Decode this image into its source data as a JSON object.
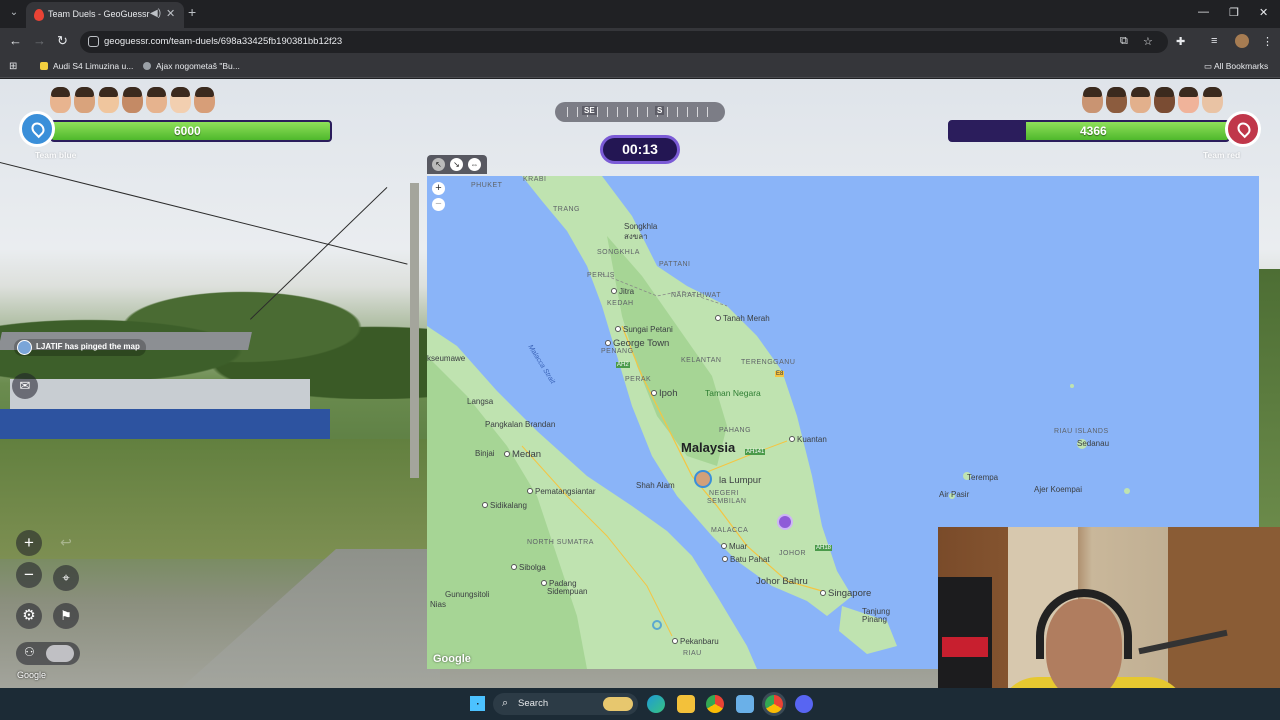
{
  "browser": {
    "tab_title": "Team Duels - GeoGuessr",
    "tab_icons": [
      "geoguessr-pin-icon",
      "speaker-icon",
      "close-icon"
    ],
    "url": "geoguessr.com/team-duels/698a33425fb190381bb12f23",
    "bookmarks": [
      {
        "label": "Audi S4 Limuzina u...",
        "color": "#f4d03f"
      },
      {
        "label": "Ajax nogometaš \"Bu...",
        "color": "#9aa0a6"
      }
    ],
    "all_bookmarks": "All Bookmarks"
  },
  "game": {
    "team_blue": {
      "label": "Team blue",
      "health": "6000",
      "health_fraction": 1.0,
      "color": "#3a8fd9"
    },
    "team_red": {
      "label": "Team red",
      "health": "4366",
      "health_fraction": 0.7277,
      "color": "#c0374a"
    },
    "compass": {
      "left": "SE",
      "center": "S"
    },
    "timer": "00:13",
    "ping_message": "LJATIF has pinged the map"
  },
  "map": {
    "labels": {
      "phuket": "PHUKET",
      "krabi": "KRABI",
      "trang": "TRANG",
      "songkhla": "Songkhla",
      "songkhla_thai": "สงขลา",
      "songkhla_region": "SONGKHLA",
      "pattani": "PATTANI",
      "perlis": "PERLIS",
      "jitra": "Jitra",
      "kedah": "KEDAH",
      "narathiwat": "NARATHIWAT",
      "tanah_merah": "Tanah Merah",
      "sungai_petani": "Sungai Petani",
      "george_town": "George Town",
      "penang": "PENANG",
      "kelantan": "KELANTAN",
      "terengganu": "TERENGGANU",
      "seumawe": "kseumawe",
      "malacca_strait": "Malacca Strait",
      "perak": "PERAK",
      "ipoh": "Ipoh",
      "taman_negara": "Taman Negara",
      "langsa": "Langsa",
      "pangkalan_brandan": "Pangkalan Brandan",
      "pahang": "PAHANG",
      "malaysia": "Malaysia",
      "kuantan": "Kuantan",
      "binjai": "Binjai",
      "medan": "Medan",
      "kuala_lumpur": "la Lumpur",
      "shah_alam": "Shah Alam",
      "negeri": "NEGERI",
      "sembilan": "SEMBILAN",
      "pematangsiantar": "Pematangsiantar",
      "sidikalang": "Sidikalang",
      "malacca": "MALACCA",
      "north_sumatra": "NORTH SUMATRA",
      "muar": "Muar",
      "johor": "JOHOR",
      "batu_pahat": "Batu Pahat",
      "sibolga": "Sibolga",
      "johor_bahru": "Johor Bahru",
      "singapore": "Singapore",
      "padang": "Padang",
      "sidempuan": "Sidempuan",
      "gunungsitoli": "Gunungsitoli",
      "nias": "Nias",
      "tanjung": "Tanjung",
      "pinang": "Pinang",
      "pekanbaru": "Pekanbaru",
      "riau": "RIAU",
      "riau_islands": "RIAU ISLANDS",
      "sedanau": "Sedanau",
      "terempa": "Terempa",
      "air_pasir": "Air Pasir",
      "ajer_koempai": "Ajer Koempai",
      "ah2": "AH2",
      "ah141": "AH141",
      "ah18": "AH18",
      "e8": "E8"
    },
    "google": "Google",
    "colors": {
      "water": "#8ab4f8",
      "land": "#bfe3b0",
      "forest": "#9fd28f"
    }
  },
  "streetview": {
    "google": "Google"
  },
  "taskbar": {
    "search_placeholder": "Search"
  }
}
